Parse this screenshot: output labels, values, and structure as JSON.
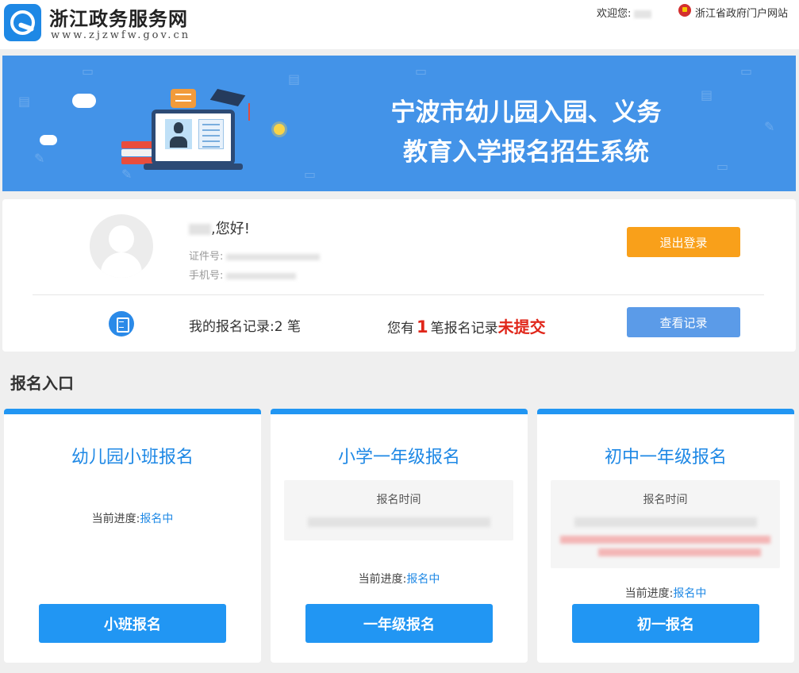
{
  "header": {
    "logo_title": "浙江政务服务网",
    "logo_url_text": "www.zjzwfw.gov.cn",
    "welcome_label": "欢迎您:",
    "gov_portal_link": "浙江省政府门户网站"
  },
  "banner": {
    "title_line1": "宁波市幼儿园入园、义务",
    "title_line2": "教育入学报名招生系统"
  },
  "user_card": {
    "greeting": ",您好!",
    "id_label": "证件号:",
    "phone_label": "手机号:",
    "logout_button": "退出登录",
    "record_label": "我的报名记录:2 笔",
    "pending_prefix": "您有",
    "pending_count": "1",
    "pending_middle": "笔报名记录",
    "pending_status": "未提交",
    "view_records_button": "查看记录"
  },
  "entries": {
    "section_title": "报名入口",
    "kindergarten": {
      "title": "幼儿园小班报名",
      "progress_label": "当前进度:",
      "progress_status": "报名中",
      "button": "小班报名"
    },
    "primary": {
      "title": "小学一年级报名",
      "time_label": "报名时间",
      "progress_label": "当前进度:",
      "progress_status": "报名中",
      "button": "一年级报名"
    },
    "junior": {
      "title": "初中一年级报名",
      "time_label": "报名时间",
      "progress_label": "当前进度:",
      "progress_status": "报名中",
      "button": "初一报名"
    }
  },
  "colors": {
    "primary_blue": "#2196f3",
    "banner_blue": "#4393e8",
    "logout_orange": "#f9a01a",
    "view_blue": "#5b9be8",
    "alert_red": "#e0261a"
  }
}
